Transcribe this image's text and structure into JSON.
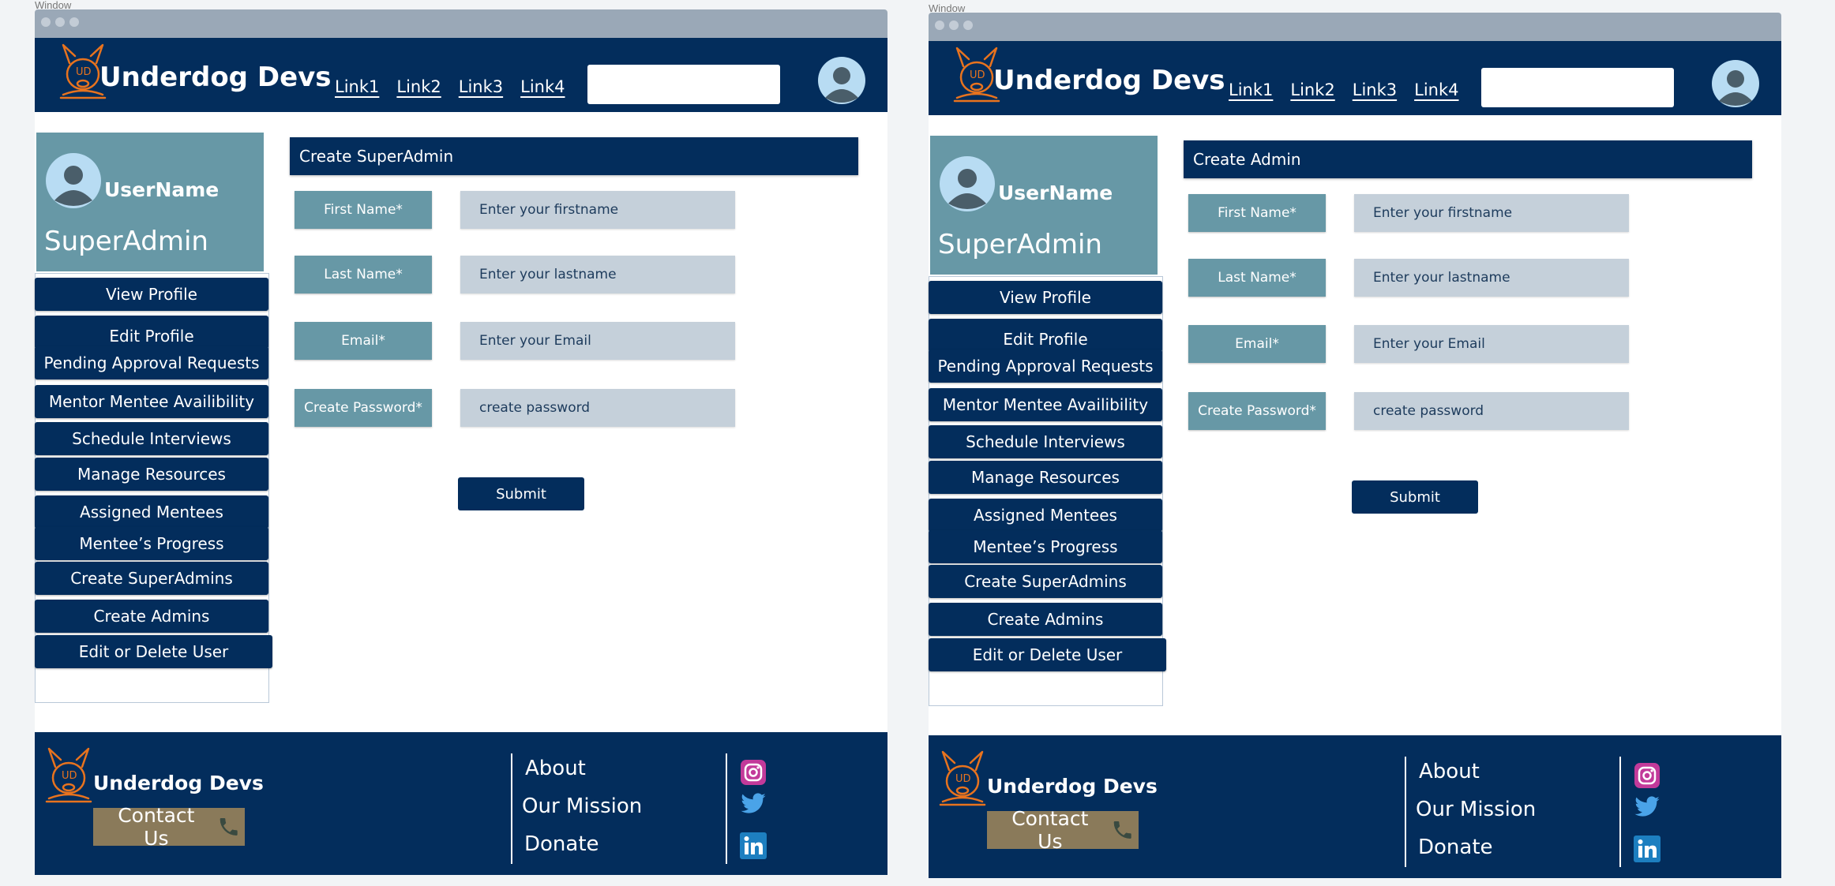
{
  "frames": [
    {
      "window_label": "Window",
      "header": {
        "brand": "Underdog Devs",
        "links": [
          "Link1",
          "Link2",
          "Link3",
          "Link4"
        ],
        "search_value": ""
      },
      "profile": {
        "username": "UserName",
        "role": "SuperAdmin"
      },
      "sidebar": {
        "items": [
          "View Profile",
          "Edit Profile",
          "Pending Approval Requests",
          "Mentor Mentee Availibility",
          "Schedule Interviews",
          "Manage Resources",
          "Assigned Mentees",
          "Mentee’s Progress",
          "Create SuperAdmins",
          "Create Admins",
          "Edit  or Delete User"
        ]
      },
      "form": {
        "title": "Create SuperAdmin",
        "fields": [
          {
            "label": "First Name*",
            "placeholder": "Enter your firstname"
          },
          {
            "label": "Last Name*",
            "placeholder": "Enter your lastname"
          },
          {
            "label": "Email*",
            "placeholder": "Enter your Email"
          },
          {
            "label": "Create Password*",
            "placeholder": "create password"
          }
        ],
        "submit_label": "Submit"
      },
      "footer": {
        "brand": "Underdog Devs",
        "contact_label": "Contact Us",
        "links": [
          "About",
          "Our Mission",
          "Donate"
        ],
        "social_icons": [
          "instagram-icon",
          "twitter-icon",
          "linkedin-icon"
        ]
      }
    },
    {
      "window_label": "Window",
      "header": {
        "brand": "Underdog Devs",
        "links": [
          "Link1",
          "Link2",
          "Link3",
          "Link4"
        ],
        "search_value": ""
      },
      "profile": {
        "username": "UserName",
        "role": "SuperAdmin"
      },
      "sidebar": {
        "items": [
          "View Profile",
          "Edit Profile",
          "Pending Approval Requests",
          "Mentor Mentee Availibility",
          "Schedule Interviews",
          "Manage Resources",
          "Assigned Mentees",
          "Mentee’s Progress",
          "Create SuperAdmins",
          "Create Admins",
          "Edit  or Delete User"
        ]
      },
      "form": {
        "title": "Create Admin",
        "fields": [
          {
            "label": "First Name*",
            "placeholder": "Enter your firstname"
          },
          {
            "label": "Last Name*",
            "placeholder": "Enter your lastname"
          },
          {
            "label": "Email*",
            "placeholder": "Enter your Email"
          },
          {
            "label": "Create Password*",
            "placeholder": "create password"
          }
        ],
        "submit_label": "Submit"
      },
      "footer": {
        "brand": "Underdog Devs",
        "contact_label": "Contact Us",
        "links": [
          "About",
          "Our Mission",
          "Donate"
        ],
        "social_icons": [
          "instagram-icon",
          "twitter-icon",
          "linkedin-icon"
        ]
      }
    }
  ],
  "colors": {
    "navy": "#032d5c",
    "teal": "#6798a6",
    "input_bg": "#c5d0da",
    "accent_orange": "#e8731e",
    "contact_bg": "#8a7a5a",
    "chrome": "#9aa8b7"
  }
}
